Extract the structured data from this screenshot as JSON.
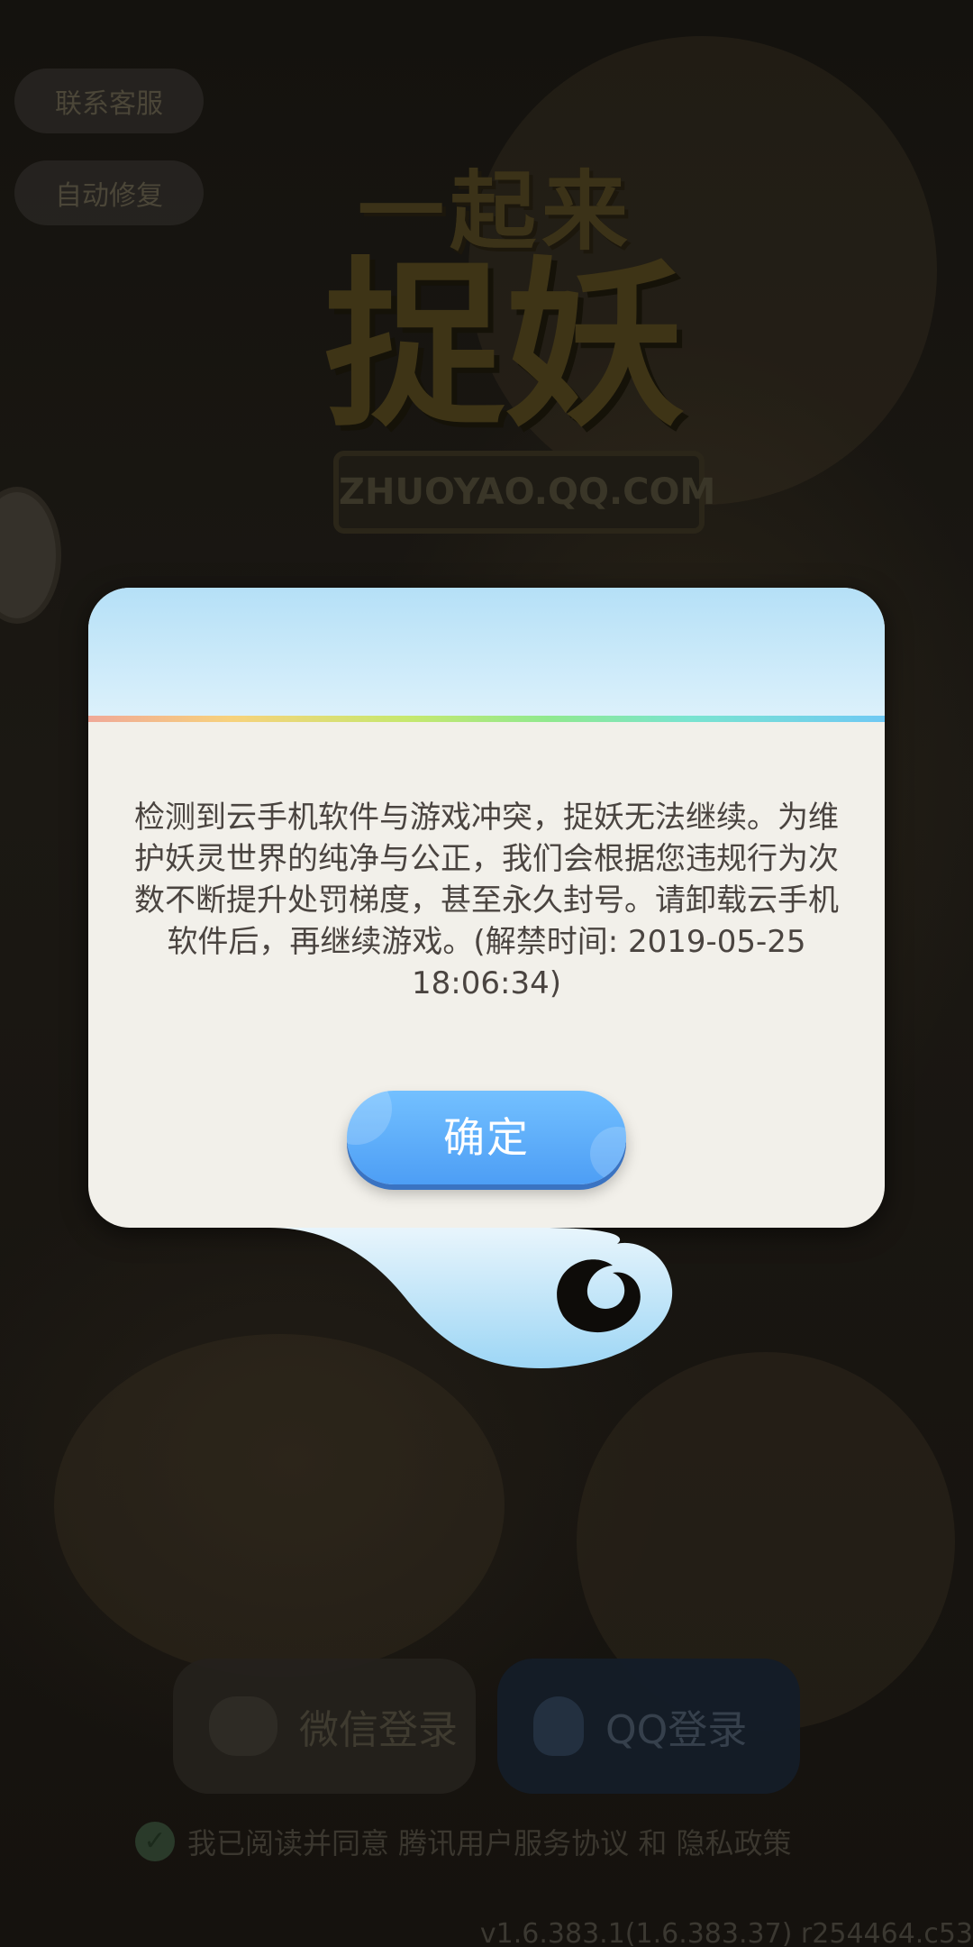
{
  "background": {
    "customer_service_label": "联系客服",
    "auto_repair_label": "自动修复",
    "logo": {
      "line1": "一起来",
      "line2": "捉妖",
      "url": "ZHUOYAO.QQ.COM"
    },
    "wechat_login_label": "微信登录",
    "qq_login_label": "QQ登录",
    "agreement_text": "我已阅读并同意 腾讯用户服务协议 和 隐私政策",
    "version": "v1.6.383.1(1.6.383.37) r254464.c53"
  },
  "dialog": {
    "message": "检测到云手机软件与游戏冲突，捉妖无法继续。为维\n护妖灵世界的纯净与公正，我们会根据您违规行为次\n数不断提升处罚梯度，甚至永久封号。请卸载云手机\n软件后，再继续游戏。(解禁时间: 2019-05-25\n18:06:34)",
    "ok_label": "确定"
  },
  "colors": {
    "dialog_bg": "#f2f0ea",
    "header_sky": "#b5e0f7",
    "button_blue": "#4d9ef5",
    "overlay_dark": "#0e0c09"
  }
}
